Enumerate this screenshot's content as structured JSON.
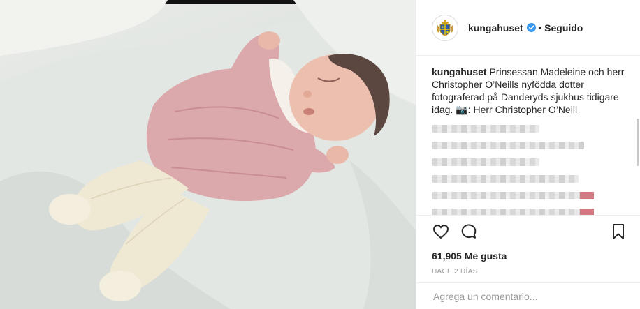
{
  "account": {
    "username": "kungahuset",
    "follow_status": "Seguido",
    "separator": "•"
  },
  "caption": {
    "username": "kungahuset",
    "text": "Prinsessan Madeleine och herr Christopher O’Neills nyfödda dotter fotograferad på Danderyds sjukhus tidigare idag. 📷: Herr Christopher O’Neill"
  },
  "blurred_comments": [
    {
      "width": 0.55,
      "pink": false
    },
    {
      "width": 0.78,
      "pink": false
    },
    {
      "width": 0.55,
      "pink": false
    },
    {
      "width": 0.75,
      "pink": false
    },
    {
      "width": 0.83,
      "pink": true
    },
    {
      "width": 0.83,
      "pink": true
    }
  ],
  "stats": {
    "likes": "61,905 Me gusta",
    "time_ago": "HACE 2 DÍAS"
  },
  "comment_input": {
    "placeholder": "Agrega un comentario..."
  },
  "icons": {
    "like": "heart-icon",
    "comment": "comment-bubble-icon",
    "save": "bookmark-icon",
    "verified": "verified-badge-icon",
    "avatar": "royal-crest-icon"
  },
  "colors": {
    "verified": "#3897f0",
    "text": "#262626",
    "muted": "#999999"
  }
}
